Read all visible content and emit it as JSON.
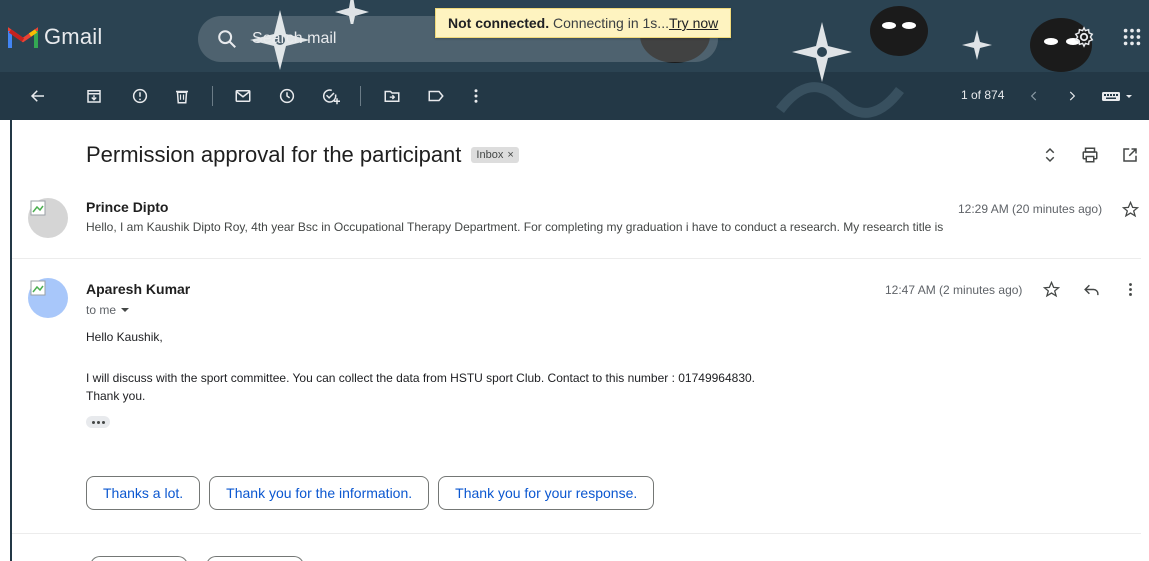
{
  "app": {
    "name": "Gmail",
    "search_placeholder": "Search mail"
  },
  "notice": {
    "bold": "Not connected.",
    "text": " Connecting in 1s...",
    "action": "Try now"
  },
  "toolbar": {
    "count": "1 of 874"
  },
  "thread": {
    "subject": "Permission approval for the participant",
    "label": "Inbox",
    "label_close": "×"
  },
  "messages": [
    {
      "sender": "Prince Dipto",
      "time": "12:29 AM (20 minutes ago)",
      "snippet": "Hello, I am Kaushik Dipto Roy, 4th year Bsc in Occupational Therapy Department. For completing my graduation i have to conduct a research. My research title is"
    },
    {
      "sender": "Aparesh Kumar",
      "time": "12:47 AM (2 minutes ago)",
      "to": "to me",
      "body": [
        "Hello Kaushik,",
        "I will discuss with the sport committee.  You can collect the data from HSTU sport Club. Contact to this number : 01749964830.",
        "Thank you."
      ]
    }
  ],
  "smart_replies": [
    "Thanks a lot.",
    "Thank you for the information.",
    "Thank you for your response."
  ],
  "colors": {
    "theme_dark": "#233846",
    "link_blue": "#0b57d0",
    "notice_bg": "#fef3c0"
  },
  "icons": {
    "toolbar": [
      "back-arrow-icon",
      "archive-icon",
      "report-spam-icon",
      "delete-icon",
      "mark-unread-icon",
      "snooze-icon",
      "add-task-icon",
      "move-to-icon",
      "label-icon",
      "more-vert-icon",
      "prev-icon",
      "next-icon",
      "input-tools-icon"
    ],
    "top": [
      "search-icon",
      "support-icon",
      "settings-icon",
      "apps-icon"
    ]
  }
}
